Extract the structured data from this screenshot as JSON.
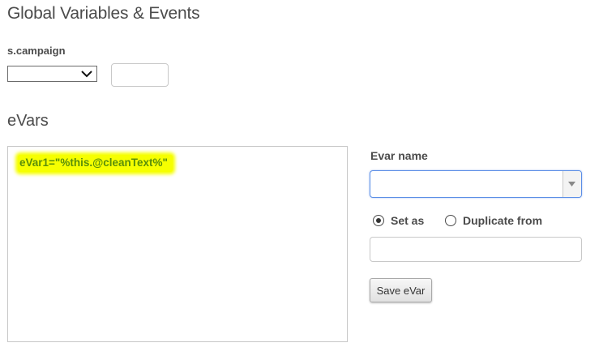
{
  "header": {
    "title": "Global Variables & Events"
  },
  "campaign": {
    "label": "s.campaign",
    "select_value": "",
    "input_value": ""
  },
  "evars": {
    "title": "eVars",
    "lines": [
      "eVar1=\"%this.@cleanText%\""
    ],
    "highlight_color": "#f6ff00",
    "text_color": "#5a8f0a"
  },
  "editor": {
    "evar_name_label": "Evar name",
    "evar_name_value": "",
    "radio_set_label": "Set as",
    "radio_set_checked": true,
    "radio_duplicate_label": "Duplicate from",
    "radio_duplicate_checked": false,
    "duplicate_input_value": "",
    "save_label": "Save eVar"
  },
  "icons": {
    "campaign_select": "chevron-down-icon",
    "evar_name_select": "triangle-down-icon"
  },
  "colors": {
    "focus_border": "#5b8ee6",
    "text": "#4b4b4b"
  }
}
